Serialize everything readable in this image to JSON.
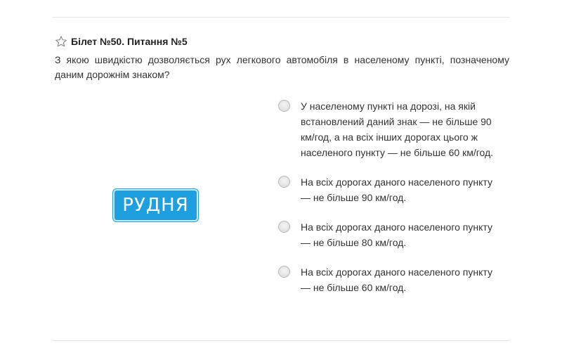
{
  "ticket": {
    "title": "Білет №50. Питання №5",
    "question": "З якою швидкістю дозволяється рух легкового автомобіля в населеному пункті, позначеному даним дорожнім знаком?"
  },
  "sign": {
    "text": "РУДНЯ",
    "color": "#1e9fe0"
  },
  "answers": [
    {
      "label": "У населеному пункті на дорозі, на якій встановлений даний знак — не більше 90 км/год, а на всіх інших дорогах цього ж населеного пункту — не більше 60 км/год."
    },
    {
      "label": "На всіх дорогах даного населеного пункту — не більше 90 км/год."
    },
    {
      "label": "На всіх дорогах даного населеного пункту — не більше 80 км/год."
    },
    {
      "label": "На всіх дорогах даного населеного пункту — не більше 60 км/год."
    }
  ],
  "icons": {
    "favorite": "star-outline-icon",
    "answer_choice": "radio-button"
  }
}
